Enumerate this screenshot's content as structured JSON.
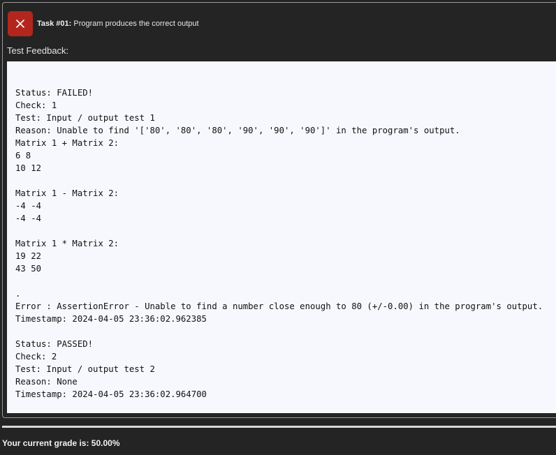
{
  "task": {
    "number_label": "Task #01:",
    "title": "Program produces the correct output"
  },
  "icons": {
    "close": "close-icon"
  },
  "colors": {
    "close_button": "#b3261e",
    "background": "#242424",
    "feedback_background": "#f6f8fd"
  },
  "feedback": {
    "label": "Test Feedback:",
    "lines": [
      "Status: FAILED!",
      "Check: 1",
      "Test: Input / output test 1",
      "Reason: Unable to find '['80', '80', '80', '90', '90', '90']' in the program's output.",
      "Matrix 1 + Matrix 2:",
      "6 8",
      "10 12",
      "",
      "Matrix 1 - Matrix 2:",
      "-4 -4",
      "-4 -4",
      "",
      "Matrix 1 * Matrix 2:",
      "19 22",
      "43 50",
      "",
      ".",
      "Error : AssertionError - Unable to find a number close enough to 80 (+/-0.00) in the program's output.",
      "Timestamp: 2024-04-05 23:36:02.962385",
      "",
      "Status: PASSED!",
      "Check: 2",
      "Test: Input / output test 2",
      "Reason: None",
      "Timestamp: 2024-04-05 23:36:02.964700"
    ]
  },
  "grade": {
    "text": "Your current grade is: 50.00%"
  }
}
